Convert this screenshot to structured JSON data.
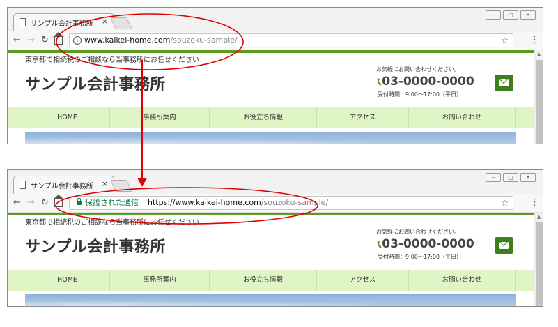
{
  "screens": [
    {
      "tab": {
        "title": "サンプル会計事務所",
        "close": "×"
      },
      "window_buttons": [
        "‒",
        "▢",
        "✕"
      ],
      "omnibox": {
        "host": "www.kaikei-home.com",
        "path": "/souzoku-sample/",
        "star": "☆"
      },
      "site": {
        "tagline": "東京都で相続税のご相談なら当事務所にお任せください！",
        "name": "サンプル会計事務所",
        "contact_note": "お気軽にお問い合わせください。",
        "phone": "03-0000-0000",
        "hours": "受付時間：9:00〜17:00（平日）",
        "nav": [
          "HOME",
          "事務所案内",
          "お役立ち情報",
          "アクセス",
          "お問い合わせ"
        ]
      }
    },
    {
      "tab": {
        "title": "サンプル会計事務所",
        "close": "×"
      },
      "window_buttons": [
        "‒",
        "▢",
        "✕"
      ],
      "omnibox": {
        "secure_label": "保護された通信",
        "protocol": "https://",
        "host": "www.kaikei-home.com",
        "path": "/souzoku-sample/",
        "star": "☆"
      },
      "site": {
        "tagline": "東京都で相続税のご相談なら当事務所にお任せください！",
        "name": "サンプル会計事務所",
        "contact_note": "お気軽にお問い合わせください。",
        "phone": "03-0000-0000",
        "hours": "受付時間：9:00〜17:00（平日）",
        "nav": [
          "HOME",
          "事務所案内",
          "お役立ち情報",
          "アクセス",
          "お問い合わせ"
        ]
      }
    }
  ],
  "icons": [
    "page-icon",
    "back-icon",
    "forward-icon",
    "reload-icon",
    "home-icon",
    "info-icon",
    "lock-icon",
    "star-icon",
    "menu-icon",
    "phone-icon",
    "mail-icon"
  ],
  "colors": {
    "annotation": "#e00000",
    "site_green": "#5a9a1e",
    "nav_bg": "#dff5c6",
    "secure_green": "#0b8043"
  }
}
